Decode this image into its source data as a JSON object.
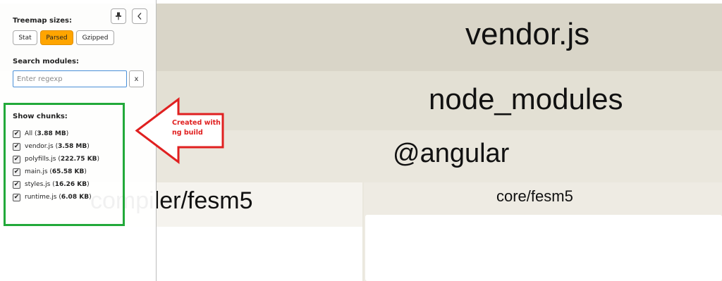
{
  "treemap": {
    "labels": {
      "vendor": "vendor.js",
      "node_modules": "node_modules",
      "angular": "@angular",
      "compiler": "compiler/fesm5",
      "core": "core/fesm5"
    }
  },
  "sidebar": {
    "pin_icon": "pin-icon",
    "collapse_icon": "chevron-left-icon",
    "treemap_sizes": {
      "title": "Treemap sizes:",
      "options": [
        "Stat",
        "Parsed",
        "Gzipped"
      ],
      "selected": "Parsed"
    },
    "search": {
      "title": "Search modules:",
      "placeholder": "Enter regexp",
      "value": "",
      "clear_label": "x"
    },
    "chunks": {
      "title": "Show chunks:",
      "items": [
        {
          "name": "All",
          "size": "3.88 MB",
          "checked": true
        },
        {
          "name": "vendor.js",
          "size": "3.58 MB",
          "checked": true
        },
        {
          "name": "polyfills.js",
          "size": "222.75 KB",
          "checked": true
        },
        {
          "name": "main.js",
          "size": "65.58 KB",
          "checked": true
        },
        {
          "name": "styles.js",
          "size": "16.26 KB",
          "checked": true
        },
        {
          "name": "runtime.js",
          "size": "6.08 KB",
          "checked": true
        }
      ]
    }
  },
  "annotation": {
    "text_line1": "Created with",
    "text_line2": "ng build",
    "arrow_color": "#e02020",
    "box_color": "#22a93a"
  },
  "colors": {
    "active_button": "#ffa500",
    "input_border": "#4a90d9"
  }
}
